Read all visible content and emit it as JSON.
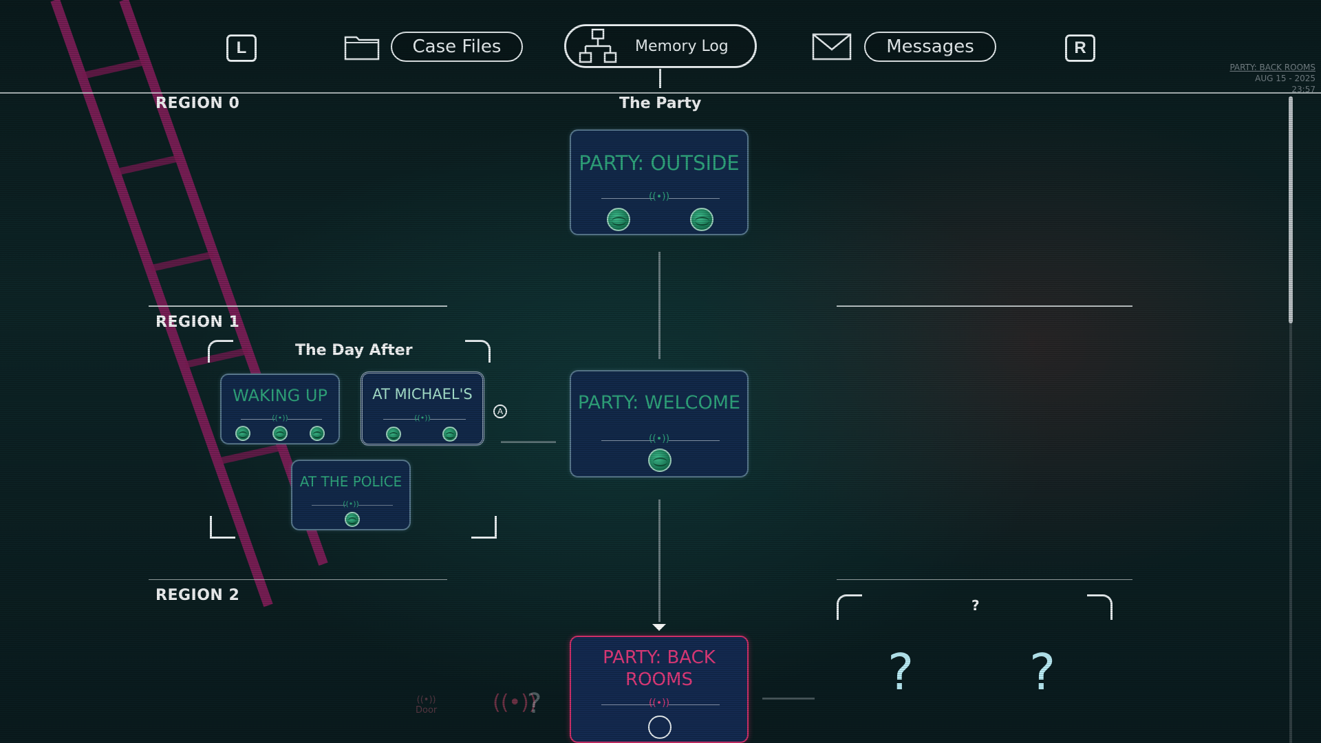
{
  "nav": {
    "left_key": "L",
    "right_key": "R",
    "case_files": "Case Files",
    "memory_log": "Memory Log",
    "messages": "Messages",
    "icons": {
      "folder": "folder-icon",
      "hierarchy": "hierarchy-icon",
      "envelope": "envelope-icon"
    }
  },
  "status": {
    "location": "PARTY: BACK ROOMS",
    "date": "AUG 15 - 2025",
    "time": "23:57"
  },
  "regions": [
    "REGION 0",
    "REGION 1",
    "REGION 2"
  ],
  "groups": {
    "main": "The Party",
    "day_after": "The Day After",
    "unknown": "?"
  },
  "cards": {
    "outside": {
      "title": "PARTY: OUTSIDE",
      "signal": "((•))",
      "orbs": 2
    },
    "welcome": {
      "title": "PARTY: WELCOME",
      "signal": "((•))",
      "orbs": 1
    },
    "waking_up": {
      "title": "WAKING UP",
      "signal": "((•))",
      "orbs": 3
    },
    "at_michaels": {
      "title": "AT MICHAEL'S",
      "signal": "((•))",
      "orbs": 2
    },
    "at_police": {
      "title": "AT THE POLICE",
      "signal": "((•))",
      "orbs": 1
    },
    "back_rooms": {
      "title_line1": "PARTY: BACK",
      "title_line2": "ROOMS",
      "signal": "((•))"
    }
  },
  "button_hint": "A",
  "hidden": {
    "q1": "?",
    "q2": "?",
    "q_small": "?",
    "door_label": "Door"
  },
  "colors": {
    "teal": "#2fa57c",
    "pink": "#e03a7a",
    "card_bg": "#12294a"
  }
}
